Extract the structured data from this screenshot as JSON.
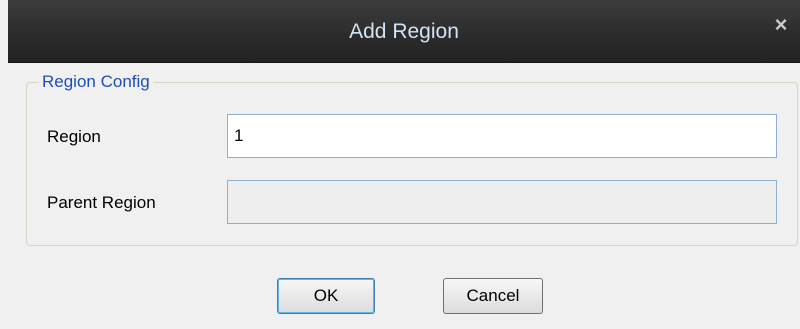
{
  "dialog": {
    "title": "Add Region",
    "close_glyph": "×",
    "close_icon": "close-icon"
  },
  "group": {
    "legend": "Region Config"
  },
  "fields": {
    "region_label": "Region",
    "region_value": "1",
    "parent_label": "Parent Region",
    "parent_value": ""
  },
  "buttons": {
    "ok_label": "OK",
    "cancel_label": "Cancel"
  },
  "colors": {
    "titlebar": "#2c2c2c",
    "title_text": "#cfe3f7",
    "legend_text": "#1f4db8",
    "input_border": "#8fb0cc"
  }
}
